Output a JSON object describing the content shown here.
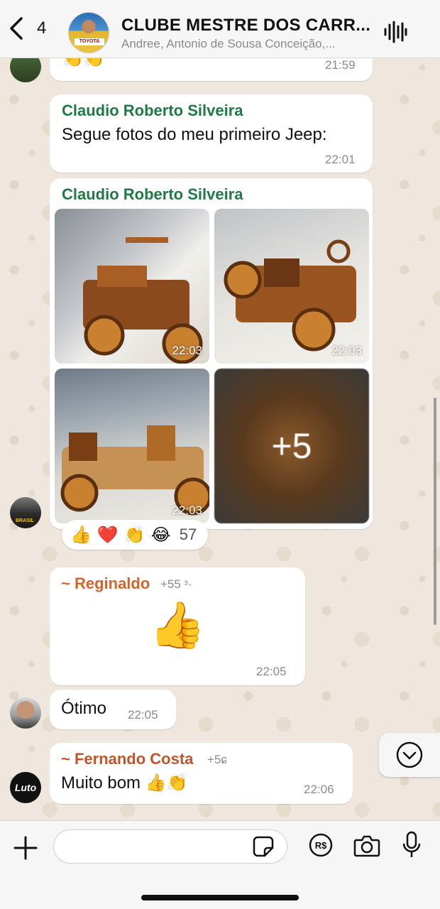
{
  "header": {
    "back_count": "4",
    "title": "CLUBE MESTRE DOS CARR...",
    "subtitle": "Andree, Antonio de Sousa Conceição,...",
    "avatar_text": "TOYOTA"
  },
  "messages": {
    "m0": {
      "emoji": "👏👏",
      "time": "21:59"
    },
    "m1": {
      "sender": "Claudio Roberto Silveira",
      "text": "Segue fotos do meu primeiro Jeep:",
      "time": "22:01"
    },
    "m2": {
      "sender": "Claudio Roberto Silveira",
      "photos": [
        {
          "time": "22:03"
        },
        {
          "time": "22:03"
        },
        {
          "time": "22:03"
        },
        {
          "more": "+5"
        }
      ],
      "reactions": {
        "emojis": [
          "👍",
          "❤️",
          "👏",
          "😂"
        ],
        "count": "57"
      },
      "avatar_text": "BRASIL"
    },
    "m3": {
      "sender": "~ Reginaldo",
      "phone": "+55 ᵌ·",
      "emoji": "👍",
      "time": "22:05"
    },
    "m4": {
      "text": "Ótimo",
      "time": "22:05"
    },
    "m5": {
      "sender": "~ Fernando Costa",
      "phone": "+5ɕ",
      "text": "Muito bom 👍👏",
      "time": "22:06",
      "avatar_text": "Luto"
    }
  },
  "input": {
    "placeholder": "",
    "value": ""
  },
  "colors": {
    "green_sender": "#1f7a45",
    "orange_sender": "#d9622b",
    "brown_sender": "#c0552a",
    "bg": "#efe7dd"
  }
}
